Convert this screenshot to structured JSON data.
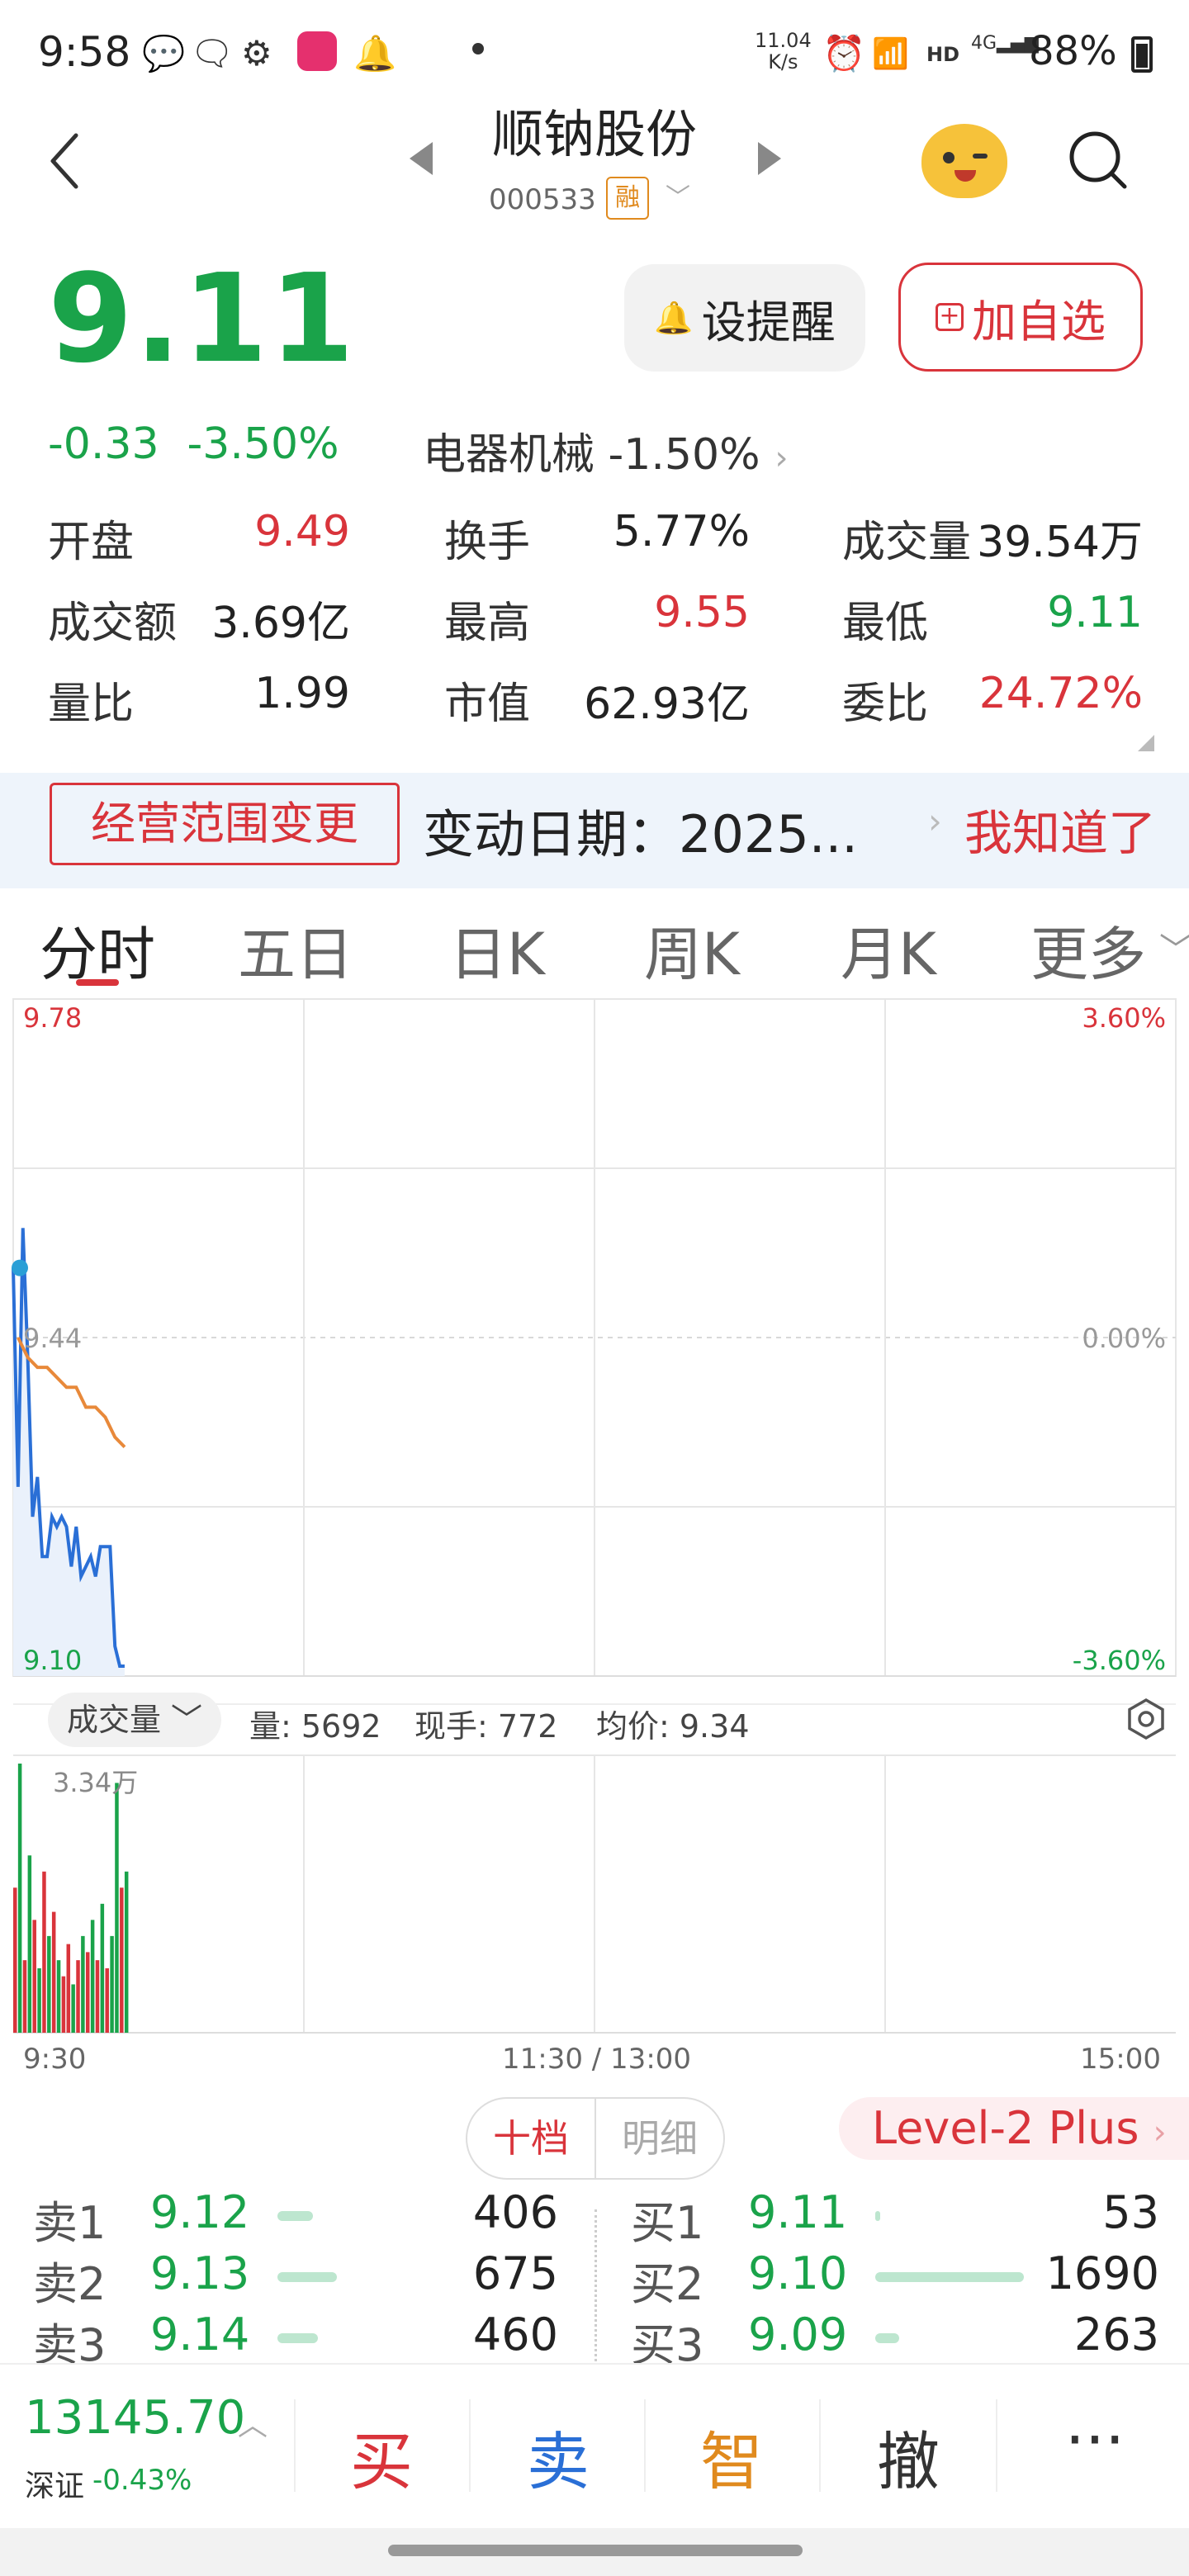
{
  "status_bar": {
    "time": "9:58",
    "net_speed_top": "11.04",
    "net_speed_bottom": "K/s",
    "battery": "88%",
    "icons": [
      "message-icon",
      "wechat-icon",
      "app-icon",
      "shop-icon",
      "bell-icon",
      "alarm-icon",
      "wifi-icon",
      "hd-icon",
      "signal-icon",
      "battery-icon"
    ]
  },
  "header": {
    "stock_name": "顺钠股份",
    "stock_code": "000533",
    "margin_badge": "融"
  },
  "quote": {
    "price": "9.11",
    "change": "-0.33",
    "change_pct": "-3.50%",
    "sector_name": "电器机械",
    "sector_change": "-1.50%",
    "alert_button": "设提醒",
    "add_button": "加自选"
  },
  "stats": [
    {
      "label": "开盘",
      "value": "9.49",
      "color": "red"
    },
    {
      "label": "换手",
      "value": "5.77%",
      "color": "dark"
    },
    {
      "label": "成交量",
      "value": "39.54万",
      "color": "dark"
    },
    {
      "label": "成交额",
      "value": "3.69亿",
      "color": "dark"
    },
    {
      "label": "最高",
      "value": "9.55",
      "color": "red"
    },
    {
      "label": "最低",
      "value": "9.11",
      "color": "green"
    },
    {
      "label": "量比",
      "value": "1.99",
      "color": "dark"
    },
    {
      "label": "市值",
      "value": "62.93亿",
      "color": "dark"
    },
    {
      "label": "委比",
      "value": "24.72%",
      "color": "red"
    }
  ],
  "notice": {
    "tag": "经营范围变更",
    "text": "变动日期：2025...",
    "dismiss": "我知道了"
  },
  "tabs": [
    "分时",
    "五日",
    "日K",
    "周K",
    "月K",
    "更多"
  ],
  "chart_data": {
    "type": "line",
    "series": [
      {
        "name": "",
        "color": "#2a6fd6",
        "x": [
          "9:30",
          "9:31",
          "9:32",
          "9:33",
          "9:34",
          "9:35",
          "9:36",
          "9:37",
          "9:38",
          "9:39",
          "9:40",
          "9:41",
          "9:42",
          "9:43",
          "9:44",
          "9:45",
          "9:46",
          "9:47",
          "9:48",
          "9:49",
          "9:50",
          "9:51",
          "9:52",
          "9:53"
        ],
        "values": [
          9.51,
          9.29,
          9.55,
          9.42,
          9.26,
          9.3,
          9.22,
          9.22,
          9.26,
          9.25,
          9.26,
          9.25,
          9.21,
          9.25,
          9.2,
          9.21,
          9.22,
          9.2,
          9.23,
          9.23,
          9.23,
          9.13,
          9.11,
          9.11
        ]
      },
      {
        "name": "",
        "color": "#e8893a",
        "x": [
          "9:31",
          "9:33",
          "9:35",
          "9:37",
          "9:39",
          "9:41",
          "9:43",
          "9:45",
          "9:47",
          "9:49",
          "9:51",
          "9:53"
        ],
        "values": [
          9.44,
          9.42,
          9.41,
          9.41,
          9.4,
          9.39,
          9.39,
          9.37,
          9.37,
          9.36,
          9.34,
          9.33
        ]
      }
    ],
    "y_left_labels": [
      "9.78",
      "9.44",
      "9.10"
    ],
    "y_right_labels": [
      "3.60%",
      "0.00%",
      "-3.60%"
    ],
    "ylim": [
      9.1,
      9.78
    ],
    "x_labels": [
      "9:30",
      "11:30 / 13:00",
      "15:00"
    ],
    "volume": {
      "max_label": "3.34万",
      "bars": [
        18000,
        33400,
        9000,
        22000,
        14000,
        8000,
        20000,
        12000,
        15000,
        9000,
        7000,
        11000,
        6000,
        9000,
        12000,
        10000,
        14000,
        9000,
        16000,
        8000,
        12000,
        31000,
        18000,
        20000
      ],
      "colors": [
        "r",
        "g",
        "r",
        "g",
        "r",
        "g",
        "r",
        "g",
        "r",
        "g",
        "r",
        "r",
        "g",
        "r",
        "g",
        "r",
        "g",
        "r",
        "g",
        "r",
        "g",
        "g",
        "r",
        "g"
      ]
    }
  },
  "volume_bar": {
    "selector": "成交量",
    "vol_label": "量: 5692",
    "hand_label": "现手: 772",
    "avg_label": "均价: 9.34"
  },
  "orderbook": {
    "tab_on": "十档",
    "tab_off": "明细",
    "level2": "Level-2 Plus",
    "sell": [
      {
        "label": "卖1",
        "price": "9.12",
        "qty": "406",
        "bar": 0.24
      },
      {
        "label": "卖2",
        "price": "9.13",
        "qty": "675",
        "bar": 0.4
      },
      {
        "label": "卖3",
        "price": "9.14",
        "qty": "460",
        "bar": 0.27
      }
    ],
    "buy": [
      {
        "label": "买1",
        "price": "9.11",
        "qty": "53",
        "bar": 0.03
      },
      {
        "label": "买2",
        "price": "9.10",
        "qty": "1690",
        "bar": 1.0
      },
      {
        "label": "买3",
        "price": "9.09",
        "qty": "263",
        "bar": 0.16
      }
    ]
  },
  "bottom": {
    "index_value": "13145.70",
    "index_name": "深证",
    "index_change": "-0.43%",
    "buy": "买",
    "sell": "卖",
    "smart": "智",
    "cancel": "撤",
    "more": "···"
  },
  "colors": {
    "up": "#d9343b",
    "down": "#1aa34a",
    "price_line": "#2a6fd6",
    "avg_line": "#e8893a"
  }
}
